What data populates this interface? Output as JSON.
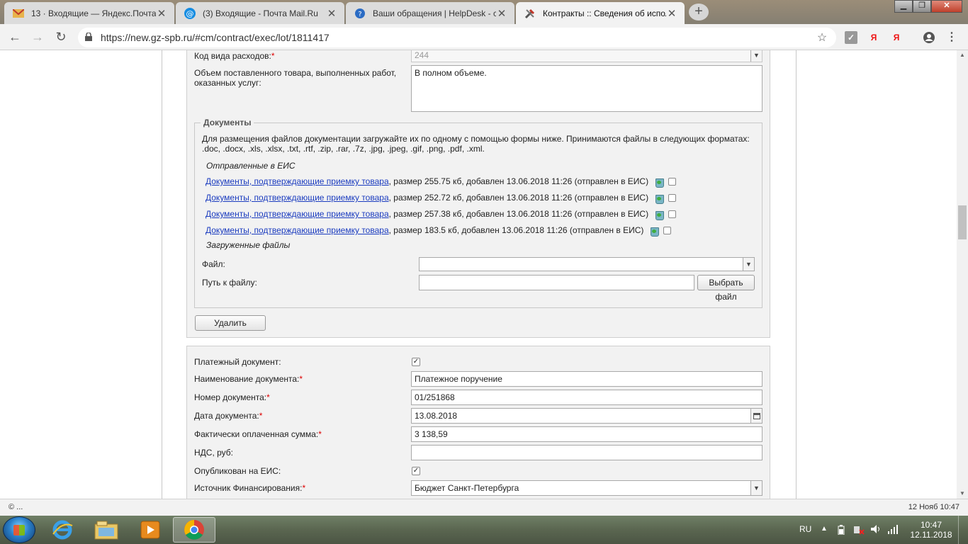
{
  "browser": {
    "tabs": [
      {
        "title": "13 · Входящие — Яндекс.Почта",
        "icon": "mail-envelope-icon",
        "active": false
      },
      {
        "title": "(3) Входящие - Почта Mail.Ru",
        "icon": "at-sign-icon",
        "active": false
      },
      {
        "title": "Ваши обращения | HelpDesk - с",
        "icon": "helpdesk-globe-icon",
        "active": false
      },
      {
        "title": "Контракты :: Сведения об испол",
        "icon": "tools-icon",
        "active": true
      }
    ],
    "url": "https://new.gz-spb.ru/#cm/contract/exec/lot/1811417",
    "extensions": [
      "Я",
      "Я"
    ]
  },
  "form_top": {
    "expense_code_label": "Код вида расходов:",
    "expense_code_value": "244",
    "volume_label": "Объем поставленного товара, выполненных работ, оказанных услуг:",
    "volume_value": "В полном объеме."
  },
  "documents": {
    "legend": "Документы",
    "instructions": "Для размещения файлов документации загружайте их по одному с помощью формы ниже. Принимаются файлы в следующих форматах: .doc, .docx, .xls, .xlsx, .txt, .rtf, .zip, .rar, .7z, .jpg, .jpeg, .gif, .png, .pdf, .xml.",
    "sent_heading": "Отправленные в ЕИС",
    "files": [
      {
        "name": "Документы, подтверждающие приемку товара",
        "info": ", размер 255.75 кб, добавлен 13.06.2018 11:26 (отправлен в ЕИС)"
      },
      {
        "name": "Документы, подтверждающие приемку товара",
        "info": ", размер 252.72 кб, добавлен 13.06.2018 11:26 (отправлен в ЕИС)"
      },
      {
        "name": "Документы, подтверждающие приемку товара",
        "info": ", размер 257.38 кб, добавлен 13.06.2018 11:26 (отправлен в ЕИС)"
      },
      {
        "name": "Документы, подтверждающие приемку товара",
        "info": ", размер 183.5 кб, добавлен 13.06.2018 11:26 (отправлен в ЕИС)"
      }
    ],
    "uploaded_heading": "Загруженные файлы",
    "file_label": "Файл:",
    "file_value": "",
    "path_label": "Путь к файлу:",
    "path_value": "",
    "choose_file_button": "Выбрать файл",
    "delete_button": "Удалить"
  },
  "payment": {
    "payment_doc_label": "Платежный документ:",
    "payment_doc_checked": true,
    "doc_name_label": "Наименование документа:",
    "doc_name_value": "Платежное поручение",
    "doc_number_label": "Номер документа:",
    "doc_number_value": "01/251868",
    "doc_date_label": "Дата документа:",
    "doc_date_value": "13.08.2018",
    "paid_sum_label": "Фактически оплаченная сумма:",
    "paid_sum_value": "3 138,59",
    "vat_label": "НДС, руб:",
    "vat_value": "",
    "published_label": "Опубликован на ЕИС:",
    "published_checked": true,
    "funding_label": "Источник Финансирования:",
    "funding_value": "Бюджет Санкт-Петербурга"
  },
  "required_mark": "*",
  "status_bar": {
    "left": "© ...",
    "right": "12 Нояб 10:47"
  },
  "taskbar": {
    "lang": "RU",
    "time": "10:47",
    "date": "12.11.2018"
  }
}
